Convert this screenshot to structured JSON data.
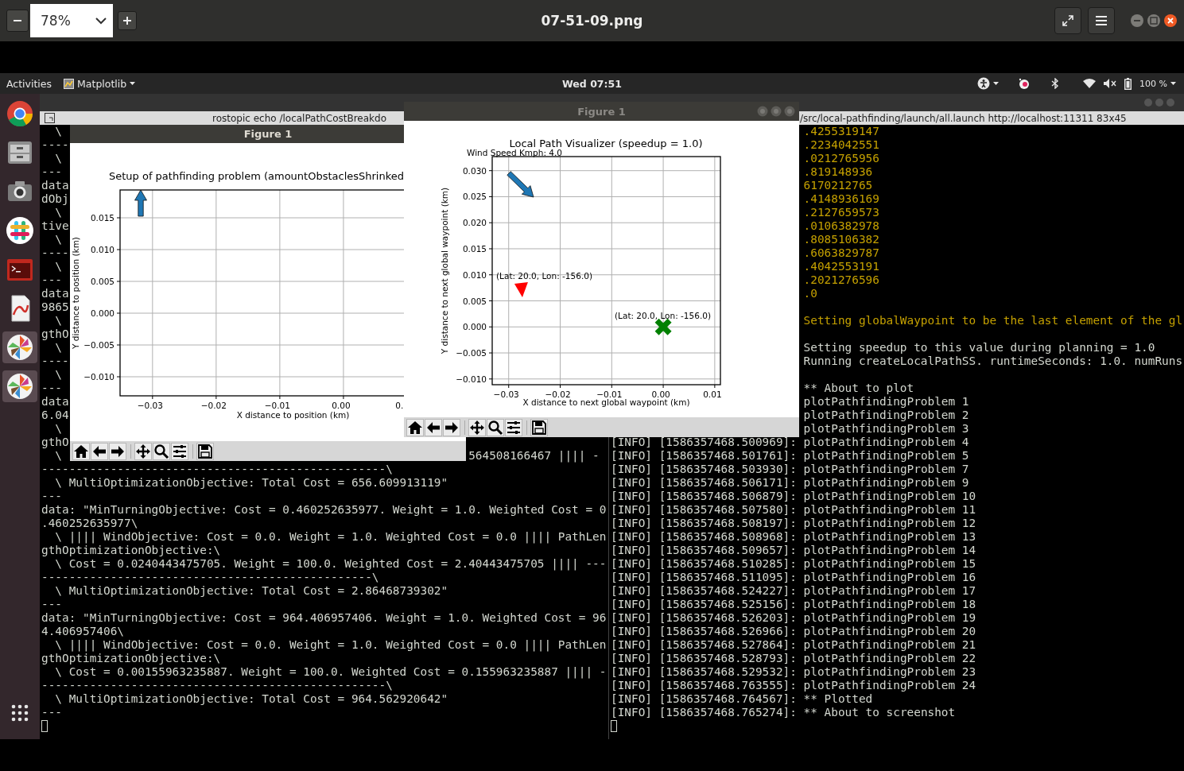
{
  "image_viewer": {
    "zoom": "78%",
    "title": "07-51-09.png"
  },
  "top_panel": {
    "activities": "Activities",
    "app_menu": "Matplotlib",
    "clock": "Wed 07:51",
    "battery": "100 %"
  },
  "dock": {
    "items": [
      {
        "kind": "browser",
        "selected": false
      },
      {
        "kind": "files",
        "selected": false
      },
      {
        "kind": "camera",
        "selected": false
      },
      {
        "kind": "chat",
        "selected": false
      },
      {
        "kind": "terminal",
        "selected": false
      },
      {
        "kind": "document",
        "selected": false
      },
      {
        "kind": "pinwheel",
        "selected": true
      },
      {
        "kind": "pinwheel",
        "selected": true
      }
    ]
  },
  "terminals": [
    {
      "title": "rostopic echo /localPathCostBreakdo",
      "clipped_lines": [
        {
          "text": "  \\",
          "kind": "plain"
        },
        {
          "text": "----",
          "kind": "plain"
        },
        {
          "text": "  \\",
          "kind": "plain"
        },
        {
          "text": "---",
          "kind": "plain"
        },
        {
          "text": "data",
          "kind": "plain"
        },
        {
          "text": "dObj",
          "kind": "plain"
        },
        {
          "text": "  \\",
          "kind": "plain"
        },
        {
          "text": "tive",
          "kind": "plain"
        },
        {
          "text": "  \\",
          "kind": "plain"
        },
        {
          "text": "----",
          "kind": "plain"
        },
        {
          "text": "  \\",
          "kind": "plain"
        },
        {
          "text": "---",
          "kind": "plain"
        },
        {
          "text": "data",
          "kind": "plain"
        },
        {
          "text": "9865",
          "kind": "plain"
        },
        {
          "text": "  \\",
          "kind": "plain"
        },
        {
          "text": "gthO",
          "kind": "plain"
        },
        {
          "text": "  \\",
          "kind": "plain"
        },
        {
          "text": "----",
          "kind": "plain"
        },
        {
          "text": "  \\",
          "kind": "plain"
        },
        {
          "text": "---",
          "kind": "plain"
        },
        {
          "text": "data",
          "kind": "plain"
        },
        {
          "text": "6.04",
          "kind": "plain"
        },
        {
          "text": "  \\",
          "kind": "plain"
        },
        {
          "text": "gthO",
          "kind": "plain"
        },
        {
          "text": "  \\",
          "kind": "plain",
          "tail": "564508166467 |||| -"
        }
      ],
      "lines": [
        {
          "text": "--------------------------------------------------\\",
          "kind": "plain"
        },
        {
          "text": "  \\ MultiOptimizationObjective: Total Cost = 656.609913119\"",
          "kind": "plain"
        },
        {
          "text": "---",
          "kind": "plain"
        },
        {
          "text": "data: \"MinTurningObjective: Cost = 0.460252635977. Weight = 1.0. Weighted Cost = 0",
          "kind": "plain"
        },
        {
          "text": ".460252635977\\",
          "kind": "plain"
        },
        {
          "text": "  \\ |||| WindObjective: Cost = 0.0. Weight = 1.0. Weighted Cost = 0.0 |||| PathLen",
          "kind": "plain"
        },
        {
          "text": "gthOptimizationObjective:\\",
          "kind": "plain"
        },
        {
          "text": "  \\ Cost = 0.0240443475705. Weight = 100.0. Weighted Cost = 2.40443475705 |||| ---",
          "kind": "plain"
        },
        {
          "text": "------------------------------------------------\\",
          "kind": "plain"
        },
        {
          "text": "  \\ MultiOptimizationObjective: Total Cost = 2.86468739302\"",
          "kind": "plain"
        },
        {
          "text": "---",
          "kind": "plain"
        },
        {
          "text": "data: \"MinTurningObjective: Cost = 964.406957406. Weight = 1.0. Weighted Cost = 96",
          "kind": "plain"
        },
        {
          "text": "4.406957406\\",
          "kind": "plain"
        },
        {
          "text": "  \\ |||| WindObjective: Cost = 0.0. Weight = 1.0. Weighted Cost = 0.0 |||| PathLen",
          "kind": "plain"
        },
        {
          "text": "gthOptimizationObjective:\\",
          "kind": "plain"
        },
        {
          "text": "  \\ Cost = 0.00155963235887. Weight = 100.0. Weighted Cost = 0.155963235887 |||| -",
          "kind": "plain"
        },
        {
          "text": "--------------------------------------------------\\",
          "kind": "plain"
        },
        {
          "text": "  \\ MultiOptimizationObjective: Total Cost = 964.562920642\"",
          "kind": "plain"
        },
        {
          "text": "---",
          "kind": "plain"
        }
      ]
    },
    {
      "title": "/src/local-pathfinding/launch/all.launch http://localhost:11311 83x45",
      "clipped_lines": [
        {
          "text": ".4255319147",
          "kind": "warning"
        },
        {
          "text": ".2234042551",
          "kind": "warning"
        },
        {
          "text": ".0212765956",
          "kind": "warning"
        },
        {
          "text": ".819148936",
          "kind": "warning"
        },
        {
          "text": "6170212765",
          "kind": "warning"
        },
        {
          "text": ".4148936169",
          "kind": "warning"
        },
        {
          "text": ".2127659573",
          "kind": "warning"
        },
        {
          "text": ".0106382978",
          "kind": "warning"
        },
        {
          "text": ".8085106382",
          "kind": "warning"
        },
        {
          "text": ".6063829787",
          "kind": "warning"
        },
        {
          "text": ".4042553191",
          "kind": "warning"
        },
        {
          "text": ".2021276596",
          "kind": "warning"
        },
        {
          "text": ".0",
          "kind": "warning"
        },
        {
          "kind": "blank"
        },
        {
          "text": "Setting globalWaypoint to be the last element of the gl",
          "kind": "warning"
        },
        {
          "kind": "blank"
        },
        {
          "text": "Setting speedup to this value during planning = 1.0",
          "kind": "plain"
        },
        {
          "text": "Running createLocalPathSS. runtimeSeconds: 1.0. numRuns",
          "kind": "plain"
        },
        {
          "kind": "blank"
        },
        {
          "text": "** About to plot",
          "kind": "plain"
        },
        {
          "text": "plotPathfindingProblem 1",
          "kind": "plain"
        },
        {
          "text": "plotPathfindingProblem 2",
          "kind": "plain"
        },
        {
          "text": "plotPathfindingProblem 3",
          "kind": "plain"
        }
      ],
      "lines": [
        {
          "text": "[INFO] [1586357468.500969]: plotPathfindingProblem 4",
          "kind": "plain"
        },
        {
          "text": "[INFO] [1586357468.501761]: plotPathfindingProblem 5",
          "kind": "plain"
        },
        {
          "text": "[INFO] [1586357468.503930]: plotPathfindingProblem 7",
          "kind": "plain"
        },
        {
          "text": "[INFO] [1586357468.506171]: plotPathfindingProblem 9",
          "kind": "plain"
        },
        {
          "text": "[INFO] [1586357468.506879]: plotPathfindingProblem 10",
          "kind": "plain"
        },
        {
          "text": "[INFO] [1586357468.507580]: plotPathfindingProblem 11",
          "kind": "plain"
        },
        {
          "text": "[INFO] [1586357468.508197]: plotPathfindingProblem 12",
          "kind": "plain"
        },
        {
          "text": "[INFO] [1586357468.508968]: plotPathfindingProblem 13",
          "kind": "plain"
        },
        {
          "text": "[INFO] [1586357468.509657]: plotPathfindingProblem 14",
          "kind": "plain"
        },
        {
          "text": "[INFO] [1586357468.510285]: plotPathfindingProblem 15",
          "kind": "plain"
        },
        {
          "text": "[INFO] [1586357468.511095]: plotPathfindingProblem 16",
          "kind": "plain"
        },
        {
          "text": "[INFO] [1586357468.524227]: plotPathfindingProblem 17",
          "kind": "plain"
        },
        {
          "text": "[INFO] [1586357468.525156]: plotPathfindingProblem 18",
          "kind": "plain"
        },
        {
          "text": "[INFO] [1586357468.526203]: plotPathfindingProblem 19",
          "kind": "plain"
        },
        {
          "text": "[INFO] [1586357468.526966]: plotPathfindingProblem 20",
          "kind": "plain"
        },
        {
          "text": "[INFO] [1586357468.527864]: plotPathfindingProblem 21",
          "kind": "plain"
        },
        {
          "text": "[INFO] [1586357468.528793]: plotPathfindingProblem 22",
          "kind": "plain"
        },
        {
          "text": "[INFO] [1586357468.529532]: plotPathfindingProblem 23",
          "kind": "plain"
        },
        {
          "text": "[INFO] [1586357468.763555]: plotPathfindingProblem 24",
          "kind": "plain"
        },
        {
          "text": "[INFO] [1586357468.764567]: ** Plotted",
          "kind": "plain"
        },
        {
          "text": "[INFO] [1586357468.765274]: ** About to screenshot",
          "kind": "plain"
        }
      ]
    }
  ],
  "figures": [
    {
      "title": "Figure 1",
      "active": true,
      "chart_data": {
        "type": "scatter",
        "grid": true,
        "title": "Setup of pathfinding problem (amountObstaclesShrinked",
        "xlabel": "X distance to position (km)",
        "ylabel": "Y distance to position (km)",
        "xlim": [
          -0.0351,
          0.01925
        ],
        "ylim": [
          -0.013,
          0.019375
        ],
        "xticks": [
          {
            "value": -0.03,
            "label": "−0.03"
          },
          {
            "value": -0.02,
            "label": "−0.02"
          },
          {
            "value": -0.01,
            "label": "−0.01"
          },
          {
            "value": 0,
            "label": "0.00"
          },
          {
            "value": 0.01,
            "label": "0."
          }
        ],
        "yticks": [
          {
            "value": -0.01,
            "label": "−0.010"
          },
          {
            "value": -0.005,
            "label": "−0.005"
          },
          {
            "value": 0,
            "label": "0.000"
          },
          {
            "value": 0.005,
            "label": "0.005"
          },
          {
            "value": 0.01,
            "label": "0.010"
          },
          {
            "value": 0.015,
            "label": "0.015"
          }
        ]
      }
    },
    {
      "title": "Figure 1",
      "active": false,
      "window_buttons": true,
      "chart_data": {
        "type": "scatter",
        "grid": true,
        "title": "Local Path Visualizer (speedup = 1.0)",
        "xlabel": "X distance to next global waypoint (km)",
        "ylabel": "Y distance to next global waypoint (km)",
        "xlim": [
          -0.0332,
          0.0111
        ],
        "ylim": [
          -0.0111,
          0.0327
        ],
        "xticks": [
          {
            "value": -0.03,
            "label": "−0.03"
          },
          {
            "value": -0.02,
            "label": "−0.02"
          },
          {
            "value": -0.01,
            "label": "−0.01"
          },
          {
            "value": 0,
            "label": "0.00"
          },
          {
            "value": 0.01,
            "label": "0.01"
          }
        ],
        "yticks": [
          {
            "value": -0.01,
            "label": "−0.010"
          },
          {
            "value": -0.005,
            "label": "−0.005"
          },
          {
            "value": 0,
            "label": "0.000"
          },
          {
            "value": 0.005,
            "label": "0.005"
          },
          {
            "value": 0.01,
            "label": "0.010"
          },
          {
            "value": 0.015,
            "label": "0.015"
          },
          {
            "value": 0.02,
            "label": "0.020"
          },
          {
            "value": 0.025,
            "label": "0.025"
          },
          {
            "value": 0.03,
            "label": "0.030"
          }
        ],
        "x": [
          -0.0275,
          0
        ],
        "series": [
          {
            "color": "#ff0000",
            "values": [
              0.0075,
              null
            ]
          },
          {
            "color": "#008000",
            "values": [
              null,
              0
            ]
          }
        ],
        "annotations": [
          "Wind Speed Kmph: 4.0",
          "(Lat: 20.0, Lon: -156.0)",
          "(Lat: 20.0, Lon: -156.0)"
        ]
      }
    }
  ]
}
